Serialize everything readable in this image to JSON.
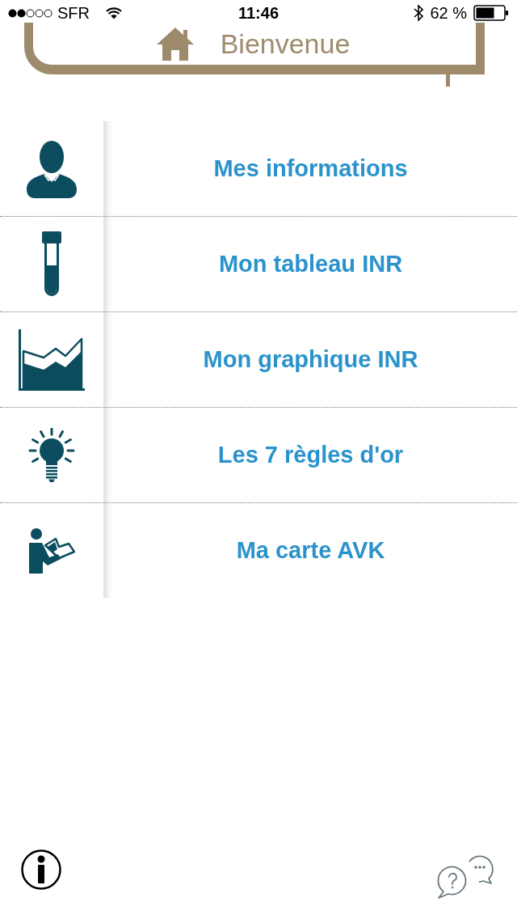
{
  "status_bar": {
    "carrier": "SFR",
    "time": "11:46",
    "battery": "62 %"
  },
  "header": {
    "title": "Bienvenue"
  },
  "menu": [
    {
      "kind": "person",
      "label": "Mes informations"
    },
    {
      "kind": "tube",
      "label": "Mon tableau INR"
    },
    {
      "kind": "chart",
      "label": "Mon graphique INR"
    },
    {
      "kind": "bulb",
      "label": "Les 7 règles d'or"
    },
    {
      "kind": "reader",
      "label": "Ma carte AVK"
    }
  ]
}
